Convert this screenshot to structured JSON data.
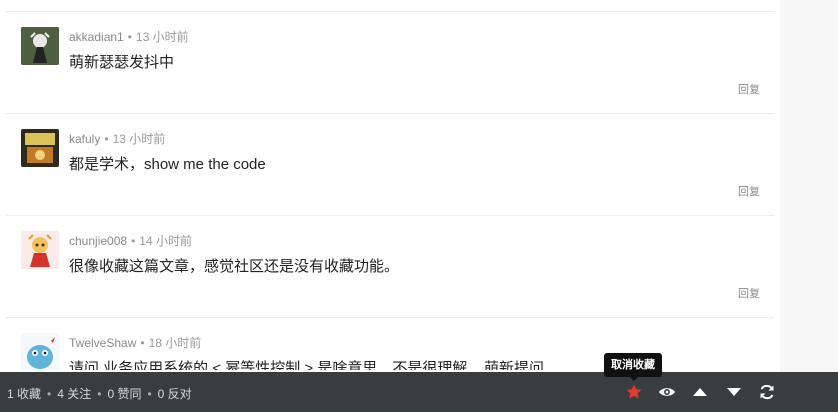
{
  "comments": [
    {
      "author": "akkadian1",
      "time": "13 小时前",
      "text": "萌新瑟瑟发抖中",
      "reply_label": "回复",
      "avatar_color": "#5c6b4a"
    },
    {
      "author": "kafuly",
      "time": "13 小时前",
      "text": "都是学术，show me the code",
      "reply_label": "回复",
      "avatar_color": "#c9a23a"
    },
    {
      "author": "chunjie008",
      "time": "14 小时前",
      "text": "很像收藏这篇文章，感觉社区还是没有收藏功能。",
      "reply_label": "回复",
      "avatar_color": "#e0b04a"
    },
    {
      "author": "TwelveShaw",
      "time": "18 小时前",
      "text": "请问 业务应用系统的 < 幂等性控制 > 是啥意思，不是很理解... 萌新提问",
      "avatar_color": "#5fb4d8"
    }
  ],
  "bottom_bar": {
    "favorites": "1 收藏",
    "follows": "4 关注",
    "likes": "0 赞同",
    "dislikes": "0 反对",
    "separator": "•",
    "active_color": "#e53935"
  },
  "tooltip": {
    "text": "取消收藏"
  },
  "icons": [
    "star-icon",
    "eye-icon",
    "arrow-up-icon",
    "arrow-down-icon",
    "refresh-icon"
  ]
}
